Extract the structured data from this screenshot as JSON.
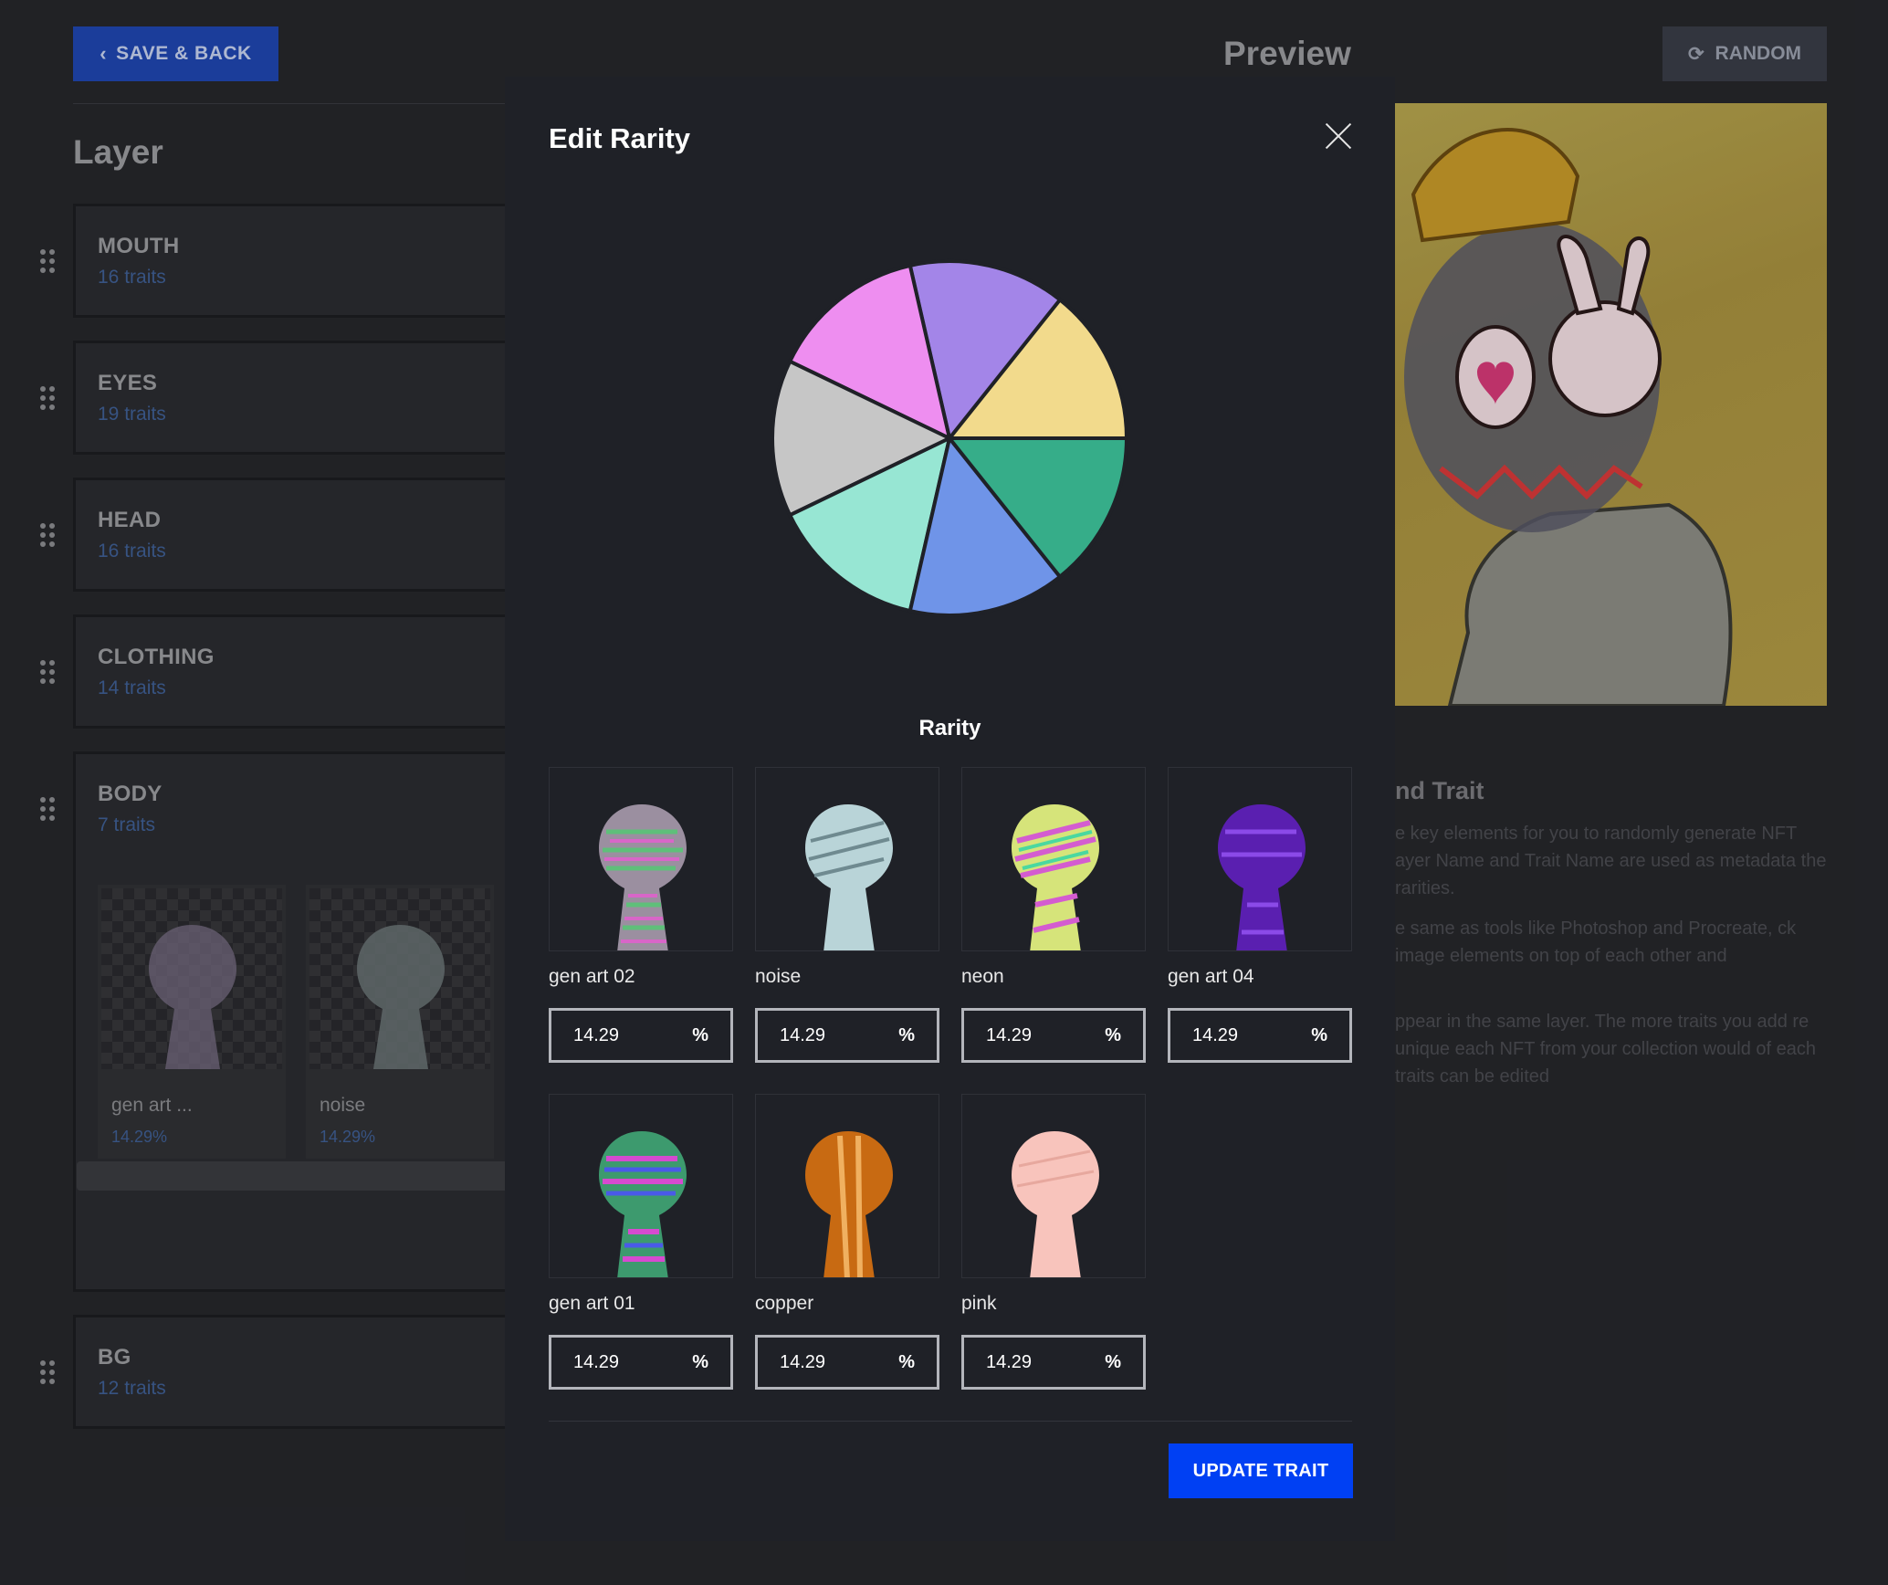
{
  "header": {
    "save_back_label": "SAVE & BACK",
    "preview_title": "Preview",
    "random_label": "RANDOM"
  },
  "layers": {
    "title": "Layer",
    "items": [
      {
        "name": "MOUTH",
        "count": "16 traits"
      },
      {
        "name": "EYES",
        "count": "19 traits"
      },
      {
        "name": "HEAD",
        "count": "16 traits"
      },
      {
        "name": "CLOTHING",
        "count": "14 traits"
      },
      {
        "name": "BODY",
        "count": "7 traits"
      },
      {
        "name": "BG",
        "count": "12 traits"
      }
    ],
    "body_thumbs": [
      {
        "name": "gen art ...",
        "pct": "14.29%"
      },
      {
        "name": "noise",
        "pct": "14.29%"
      }
    ]
  },
  "explainer": {
    "title": "nd Trait",
    "p1": "e key elements for you to randomly generate NFT ayer Name and Trait Name are used as metadata the rarities.",
    "p2": "e same as tools like Photoshop and Procreate, ck image elements on top of each other and",
    "p3": "ppear in the same layer. The more traits you add re unique each NFT from your collection would of each traits can be edited"
  },
  "modal": {
    "title": "Edit Rarity",
    "rarity_caption": "Rarity",
    "update_label": "UPDATE TRAIT",
    "traits": [
      {
        "label": "gen art 02",
        "value": "14.29",
        "unit": "%"
      },
      {
        "label": "noise",
        "value": "14.29",
        "unit": "%"
      },
      {
        "label": "neon",
        "value": "14.29",
        "unit": "%"
      },
      {
        "label": "gen art 04",
        "value": "14.29",
        "unit": "%"
      },
      {
        "label": "gen art 01",
        "value": "14.29",
        "unit": "%"
      },
      {
        "label": "copper",
        "value": "14.29",
        "unit": "%"
      },
      {
        "label": "pink",
        "value": "14.29",
        "unit": "%"
      }
    ]
  },
  "chart_data": {
    "type": "pie",
    "title": "Rarity",
    "series": [
      {
        "value": 14.29,
        "color": "#f2da8c"
      },
      {
        "value": 14.29,
        "color": "#a385e8"
      },
      {
        "value": 14.29,
        "color": "#ee8ef0"
      },
      {
        "value": 14.29,
        "color": "#c6c6c6"
      },
      {
        "value": 14.29,
        "color": "#97e6d3"
      },
      {
        "value": 14.29,
        "color": "#6f94e8"
      },
      {
        "value": 14.29,
        "color": "#36ad89"
      }
    ]
  }
}
